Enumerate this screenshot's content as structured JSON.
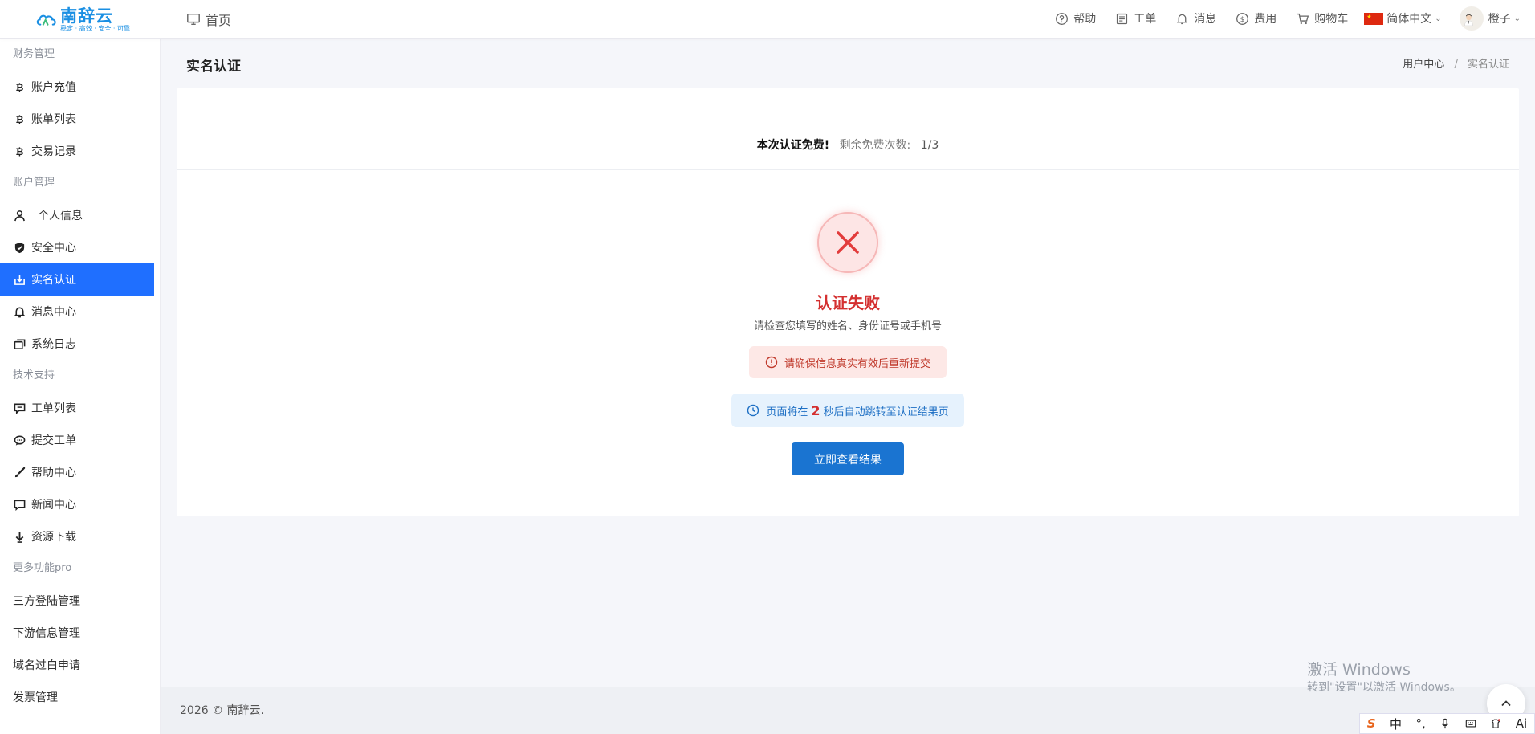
{
  "header": {
    "logo_name": "南辞云",
    "logo_slogan": "稳定 · 高效 · 安全 · 可靠",
    "home_label": "首页",
    "nav": [
      {
        "icon": "help-icon",
        "label": "帮助"
      },
      {
        "icon": "ticket-icon",
        "label": "工单"
      },
      {
        "icon": "bell-icon",
        "label": "消息"
      },
      {
        "icon": "dollar-icon",
        "label": "费用"
      },
      {
        "icon": "cart-icon",
        "label": "购物车"
      }
    ],
    "language": "简体中文",
    "username": "橙子"
  },
  "sidebar": {
    "groups": [
      {
        "title": "财务管理",
        "items": [
          {
            "label": "账户充值",
            "icon": "bitcoin-icon"
          },
          {
            "label": "账单列表",
            "icon": "bitcoin-icon"
          },
          {
            "label": "交易记录",
            "icon": "bitcoin-icon"
          }
        ]
      },
      {
        "title": "账户管理",
        "items": [
          {
            "label": "个人信息",
            "icon": "user-icon"
          },
          {
            "label": "安全中心",
            "icon": "shield-icon"
          },
          {
            "label": "实名认证",
            "icon": "id-verify-icon",
            "active": true
          },
          {
            "label": "消息中心",
            "icon": "bell-icon"
          },
          {
            "label": "系统日志",
            "icon": "log-icon"
          }
        ]
      },
      {
        "title": "技术支持",
        "items": [
          {
            "label": "工单列表",
            "icon": "comment-icon"
          },
          {
            "label": "提交工单",
            "icon": "chat-icon"
          },
          {
            "label": "帮助中心",
            "icon": "brush-icon"
          },
          {
            "label": "新闻中心",
            "icon": "news-icon"
          },
          {
            "label": "资源下载",
            "icon": "download-icon"
          }
        ]
      },
      {
        "title": "更多功能pro",
        "items": [
          {
            "label": "三方登陆管理"
          },
          {
            "label": "下游信息管理"
          },
          {
            "label": "域名过白申请"
          },
          {
            "label": "发票管理"
          }
        ]
      }
    ]
  },
  "page": {
    "title": "实名认证",
    "breadcrumb": [
      "用户中心",
      "实名认证"
    ]
  },
  "verification": {
    "free_notice": "本次认证免费!",
    "remaining_label": "剩余免费次数:",
    "remaining_count": "1/3",
    "status_title": "认证失败",
    "status_desc": "请检查您填写的姓名、身份证号或手机号",
    "warning": "请确保信息真实有效后重新提交",
    "redirect_prefix": "页面将在",
    "redirect_seconds": "2",
    "redirect_suffix": "秒后自动跳转至认证结果页",
    "button_label": "立即查看结果"
  },
  "footer": {
    "text": "2026 © 南辞云."
  },
  "watermark": {
    "line1": "激活 Windows",
    "line2": "转到\"设置\"以激活 Windows。"
  },
  "ime": {
    "mode": "中"
  },
  "colors": {
    "primary": "#1f6fff",
    "button": "#1a74d1",
    "danger": "#d43030",
    "logo": "#1a8fe3"
  }
}
